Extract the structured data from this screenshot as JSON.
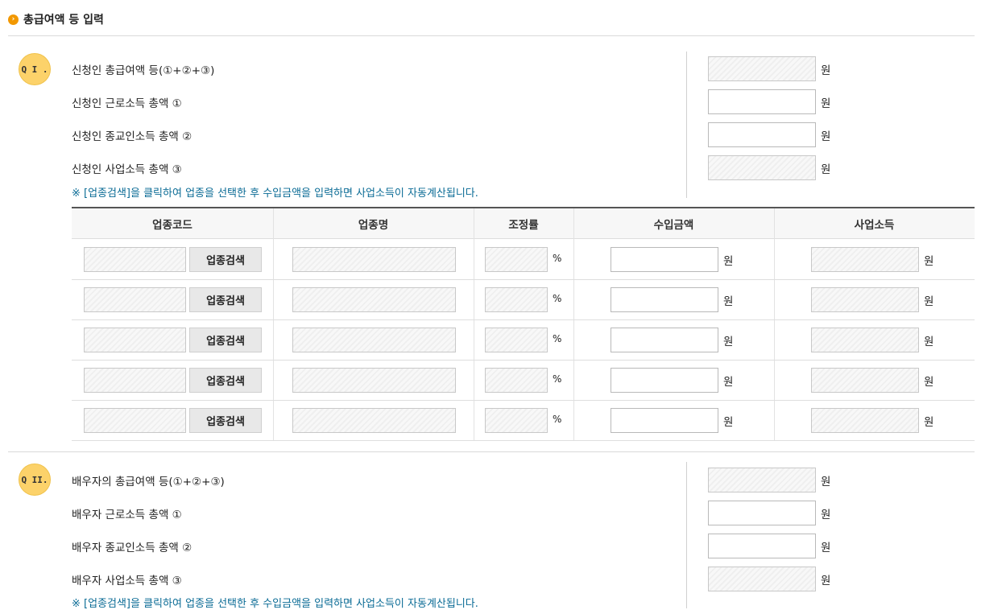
{
  "section_title": "총급여액 등 입력",
  "q1": {
    "badge": "Q I .",
    "rows": [
      {
        "label": "신청인 총급여액 등(①+②+③)",
        "unit": "원",
        "readonly": true
      },
      {
        "label": "신청인 근로소득 총액 ①",
        "unit": "원",
        "readonly": false
      },
      {
        "label": "신청인 종교인소득 총액 ②",
        "unit": "원",
        "readonly": false
      },
      {
        "label": "신청인 사업소득 총액 ③",
        "unit": "원",
        "readonly": true
      }
    ],
    "note": "※ [업종검색]을 클릭하여 업종을 선택한 후 수입금액을 입력하면 사업소득이 자동계산됩니다."
  },
  "table": {
    "headers": [
      "업종코드",
      "업종명",
      "조정률",
      "수입금액",
      "사업소득"
    ],
    "search_button": "업종검색",
    "percent_unit": "%",
    "won_unit": "원",
    "row_count": 5
  },
  "q2": {
    "badge": "Q II.",
    "rows": [
      {
        "label": "배우자의 총급여액 등(①+②+③)",
        "unit": "원",
        "readonly": true
      },
      {
        "label": "배우자 근로소득 총액 ①",
        "unit": "원",
        "readonly": false
      },
      {
        "label": "배우자 종교인소득 총액 ②",
        "unit": "원",
        "readonly": false
      },
      {
        "label": "배우자 사업소득 총액 ③",
        "unit": "원",
        "readonly": true
      }
    ],
    "note": "※ [업종검색]을 클릭하여 업종을 선택한 후 수입금액을 입력하면 사업소득이 자동계산됩니다."
  }
}
